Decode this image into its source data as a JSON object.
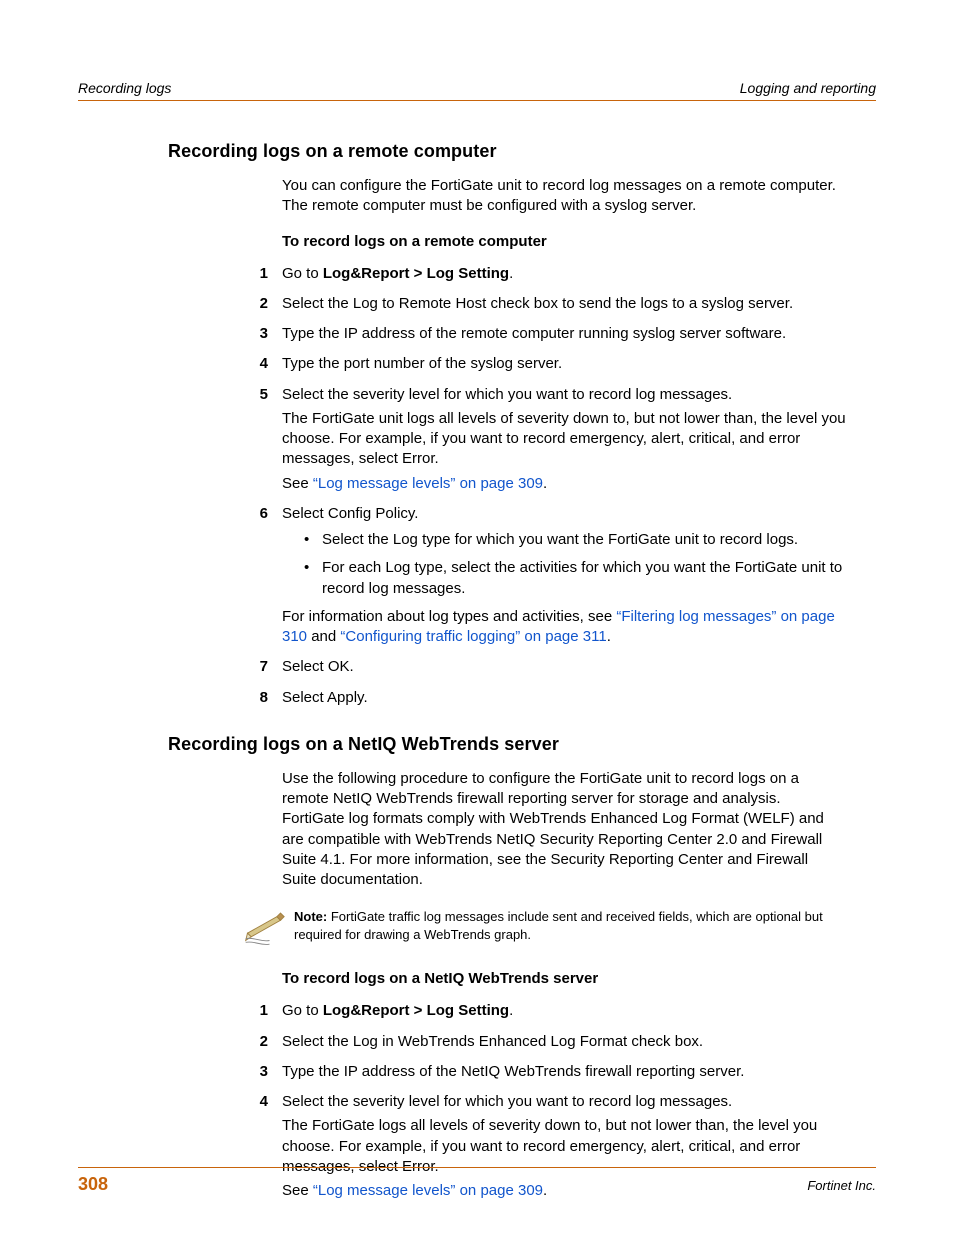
{
  "header": {
    "left": "Recording logs",
    "right": "Logging and reporting"
  },
  "section1": {
    "heading": "Recording logs on a remote computer",
    "intro": "You can configure the FortiGate unit to record log messages on a remote computer. The remote computer must be configured with a syslog server.",
    "procTitle": "To record logs on a remote computer",
    "steps": {
      "s1_a": "Go to ",
      "s1_b": "Log&Report > Log Setting",
      "s1_c": ".",
      "s2": "Select the Log to Remote Host check box to send the logs to a syslog server.",
      "s3": "Type the IP address of the remote computer running syslog server software.",
      "s4": "Type the port number of the syslog server.",
      "s5a": "Select the severity level for which you want to record log messages.",
      "s5b": "The FortiGate unit logs all levels of severity down to, but not lower than, the level you choose. For example, if you want to record emergency, alert, critical, and error messages, select Error.",
      "s5c_pre": "See ",
      "s5c_link": "“Log message levels” on page 309",
      "s5c_post": ".",
      "s6a": "Select Config Policy.",
      "s6b1": "Select the Log type for which you want the FortiGate unit to record logs.",
      "s6b2": "For each Log type, select the activities for which you want the FortiGate unit to record log messages.",
      "s6c_pre": "For information about log types and activities, see ",
      "s6c_link1": "“Filtering log messages” on page 310",
      "s6c_mid": " and ",
      "s6c_link2": "“Configuring traffic logging” on page 311",
      "s6c_post": ".",
      "s7": "Select OK.",
      "s8": "Select Apply."
    }
  },
  "section2": {
    "heading": "Recording logs on a NetIQ WebTrends server",
    "intro": "Use the following procedure to configure the FortiGate unit to record logs on a remote NetIQ WebTrends firewall reporting server for storage and analysis. FortiGate log formats comply with WebTrends Enhanced Log Format (WELF) and are compatible with WebTrends NetIQ Security Reporting Center 2.0 and Firewall Suite 4.1. For more information, see the Security Reporting Center and Firewall Suite documentation.",
    "note_label": "Note: ",
    "note_body": "FortiGate traffic log messages include sent and received fields, which are optional but required for drawing a WebTrends graph.",
    "procTitle": "To record logs on a NetIQ WebTrends server",
    "steps": {
      "s1_a": "Go to ",
      "s1_b": "Log&Report > Log Setting",
      "s1_c": ".",
      "s2": "Select the Log in WebTrends Enhanced Log Format check box.",
      "s3": "Type the IP address of the NetIQ WebTrends firewall reporting server.",
      "s4a": "Select the severity level for which you want to record log messages.",
      "s4b": "The FortiGate logs all levels of severity down to, but not lower than, the level you choose. For example, if you want to record emergency, alert, critical, and error messages, select Error.",
      "s4c_pre": "See ",
      "s4c_link": "“Log message levels” on page 309",
      "s4c_post": "."
    }
  },
  "footer": {
    "page": "308",
    "company": "Fortinet Inc."
  },
  "nums": {
    "n1": "1",
    "n2": "2",
    "n3": "3",
    "n4": "4",
    "n5": "5",
    "n6": "6",
    "n7": "7",
    "n8": "8"
  }
}
